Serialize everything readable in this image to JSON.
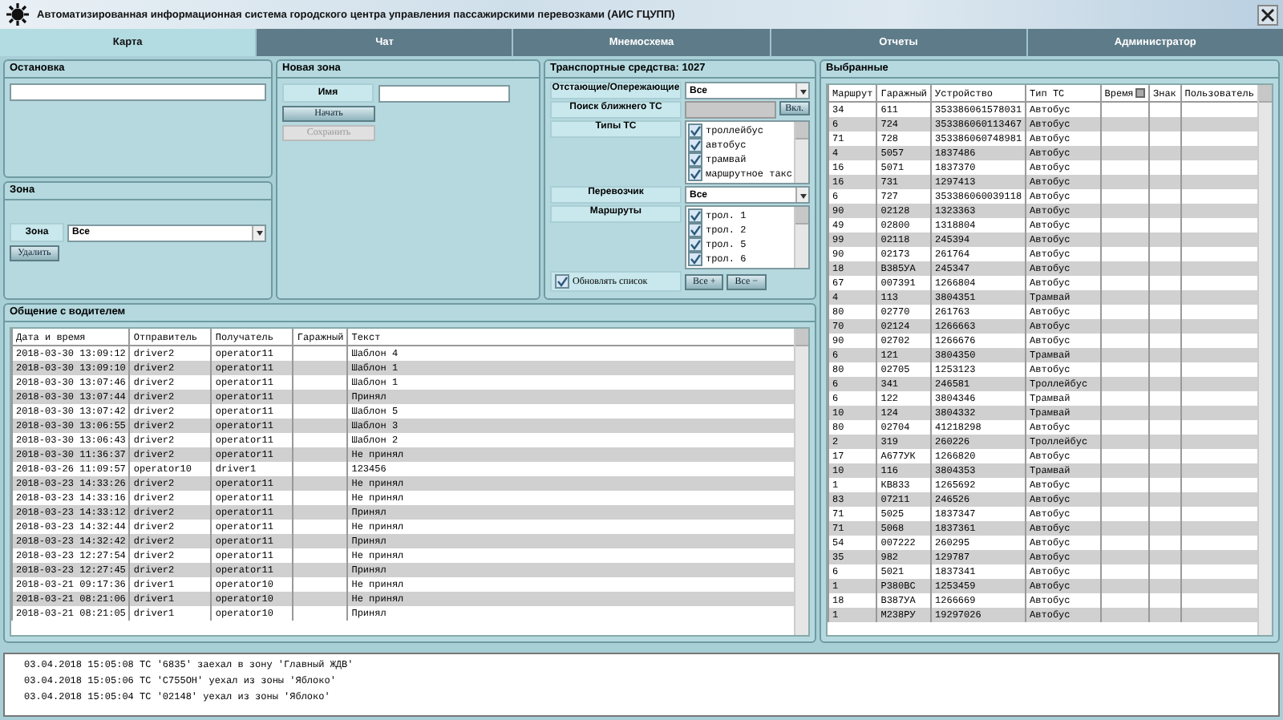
{
  "window": {
    "title": "Автоматизированная информационная система городского центра управления пассажирскими перевозками (АИС ГЦУПП)"
  },
  "tabs": [
    {
      "label": "Карта",
      "selected": true
    },
    {
      "label": "Чат",
      "selected": false
    },
    {
      "label": "Мнемосхема",
      "selected": false
    },
    {
      "label": "Отчеты",
      "selected": false
    },
    {
      "label": "Администратор",
      "selected": false
    }
  ],
  "stop_panel": {
    "title": "Остановка"
  },
  "zone_panel": {
    "title": "Зона",
    "label": "Зона",
    "select": "Все",
    "button": "Удалить"
  },
  "new_zone_panel": {
    "title": "Новая зона",
    "name_label": "Имя",
    "buttons": [
      {
        "label": "Начать",
        "disabled": false
      },
      {
        "label": "Сохранить",
        "disabled": true
      }
    ]
  },
  "vehicles_panel": {
    "title": "Транспортные средства: 1027",
    "lag_label": "Отстающие/Опережающие",
    "lag_select": "Все",
    "search_label": "Поиск ближнего ТС",
    "search_button": "Вкл.",
    "types_label": "Типы ТС",
    "types": [
      {
        "label": "троллейбус",
        "checked": true
      },
      {
        "label": "автобус",
        "checked": true
      },
      {
        "label": "трамвай",
        "checked": true
      },
      {
        "label": "маршрутное такс",
        "checked": true
      }
    ],
    "carrier_label": "Перевозчик",
    "carrier_select": "Все",
    "routes_label": "Маршруты",
    "routes": [
      {
        "label": "трол. 1",
        "checked": true
      },
      {
        "label": "трол. 2",
        "checked": true
      },
      {
        "label": "трол. 5",
        "checked": true
      },
      {
        "label": "трол. 6",
        "checked": true
      }
    ],
    "refresh": {
      "label": "Обновлять список",
      "checked": true
    },
    "buttons": [
      "Все +",
      "Все −"
    ]
  },
  "messages": {
    "title": "Общение с водителем",
    "columns": [
      "Дата и время",
      "Отправитель",
      "Получатель",
      "Гаражный",
      "Текст"
    ],
    "rows": [
      [
        "2018-03-30 13:09:12",
        "driver2",
        "operator11",
        "",
        "Шаблон 4"
      ],
      [
        "2018-03-30 13:09:10",
        "driver2",
        "operator11",
        "",
        "Шаблон 1"
      ],
      [
        "2018-03-30 13:07:46",
        "driver2",
        "operator11",
        "",
        "Шаблон 1"
      ],
      [
        "2018-03-30 13:07:44",
        "driver2",
        "operator11",
        "",
        "Принял"
      ],
      [
        "2018-03-30 13:07:42",
        "driver2",
        "operator11",
        "",
        "Шаблон 5"
      ],
      [
        "2018-03-30 13:06:55",
        "driver2",
        "operator11",
        "",
        "Шаблон 3"
      ],
      [
        "2018-03-30 13:06:43",
        "driver2",
        "operator11",
        "",
        "Шаблон 2"
      ],
      [
        "2018-03-30 11:36:37",
        "driver2",
        "operator11",
        "",
        "Не принял"
      ],
      [
        "2018-03-26 11:09:57",
        "operator10",
        "driver1",
        "",
        "123456"
      ],
      [
        "2018-03-23 14:33:26",
        "driver2",
        "operator11",
        "",
        "Не принял"
      ],
      [
        "2018-03-23 14:33:16",
        "driver2",
        "operator11",
        "",
        "Не принял"
      ],
      [
        "2018-03-23 14:33:12",
        "driver2",
        "operator11",
        "",
        "Принял"
      ],
      [
        "2018-03-23 14:32:44",
        "driver2",
        "operator11",
        "",
        "Не принял"
      ],
      [
        "2018-03-23 14:32:42",
        "driver2",
        "operator11",
        "",
        "Принял"
      ],
      [
        "2018-03-23 12:27:54",
        "driver2",
        "operator11",
        "",
        "Не принял"
      ],
      [
        "2018-03-23 12:27:45",
        "driver2",
        "operator11",
        "",
        "Принял"
      ],
      [
        "2018-03-21 09:17:36",
        "driver1",
        "operator10",
        "",
        "Не принял"
      ],
      [
        "2018-03-21 08:21:06",
        "driver1",
        "operator10",
        "",
        "Не принял"
      ],
      [
        "2018-03-21 08:21:05",
        "driver1",
        "operator10",
        "",
        "Принял"
      ]
    ]
  },
  "selected_panel": {
    "title": "Выбранные",
    "columns": [
      "Маршрут",
      "Гаражный",
      "Устройство",
      "Тип ТС",
      "Время",
      "Знак",
      "Пользователь"
    ],
    "rows": [
      [
        "34",
        "611",
        "353386061578031",
        "Автобус"
      ],
      [
        "6",
        "724",
        "353386060113467",
        "Автобус"
      ],
      [
        "71",
        "728",
        "353386060748981",
        "Автобус"
      ],
      [
        "4",
        "5057",
        "1837486",
        "Автобус"
      ],
      [
        "16",
        "5071",
        "1837370",
        "Автобус"
      ],
      [
        "16",
        "731",
        "1297413",
        "Автобус"
      ],
      [
        "6",
        "727",
        "353386060039118",
        "Автобус"
      ],
      [
        "90",
        "02128",
        "1323363",
        "Автобус"
      ],
      [
        "49",
        "02800",
        "1318804",
        "Автобус"
      ],
      [
        "99",
        "02118",
        "245394",
        "Автобус"
      ],
      [
        "90",
        "02173",
        "261764",
        "Автобус"
      ],
      [
        "18",
        "В385УА",
        "245347",
        "Автобус"
      ],
      [
        "67",
        "007391",
        "1266804",
        "Автобус"
      ],
      [
        "4",
        "113",
        "3804351",
        "Трамвай"
      ],
      [
        "80",
        "02770",
        "261763",
        "Автобус"
      ],
      [
        "70",
        "02124",
        "1266663",
        "Автобус"
      ],
      [
        "90",
        "02702",
        "1266676",
        "Автобус"
      ],
      [
        "6",
        "121",
        "3804350",
        "Трамвай"
      ],
      [
        "80",
        "02705",
        "1253123",
        "Автобус"
      ],
      [
        "6",
        "341",
        "246581",
        "Троллейбус"
      ],
      [
        "6",
        "122",
        "3804346",
        "Трамвай"
      ],
      [
        "10",
        "124",
        "3804332",
        "Трамвай"
      ],
      [
        "80",
        "02704",
        "41218298",
        "Автобус"
      ],
      [
        "2",
        "319",
        "260226",
        "Троллейбус"
      ],
      [
        "17",
        "А677УК",
        "1266820",
        "Автобус"
      ],
      [
        "10",
        "116",
        "3804353",
        "Трамвай"
      ],
      [
        "1",
        "КВ833",
        "1265692",
        "Автобус"
      ],
      [
        "83",
        "07211",
        "246526",
        "Автобус"
      ],
      [
        "71",
        "5025",
        "1837347",
        "Автобус"
      ],
      [
        "71",
        "5068",
        "1837361",
        "Автобус"
      ],
      [
        "54",
        "007222",
        "260295",
        "Автобус"
      ],
      [
        "35",
        "982",
        "129787",
        "Автобус"
      ],
      [
        "6",
        "5021",
        "1837341",
        "Автобус"
      ],
      [
        "1",
        "Р380ВС",
        "1253459",
        "Автобус"
      ],
      [
        "18",
        "В387УА",
        "1266669",
        "Автобус"
      ],
      [
        "1",
        "М238РУ",
        "19297026",
        "Автобус"
      ]
    ]
  },
  "log": [
    "03.04.2018 15:05:08 ТС '6835' заехал в зону 'Главный ЖДВ'",
    "03.04.2018 15:05:06 ТС 'С755ОН' уехал из зоны 'Яблоко'",
    "03.04.2018 15:05:04 ТС '02148' уехал из зоны 'Яблоко'"
  ]
}
